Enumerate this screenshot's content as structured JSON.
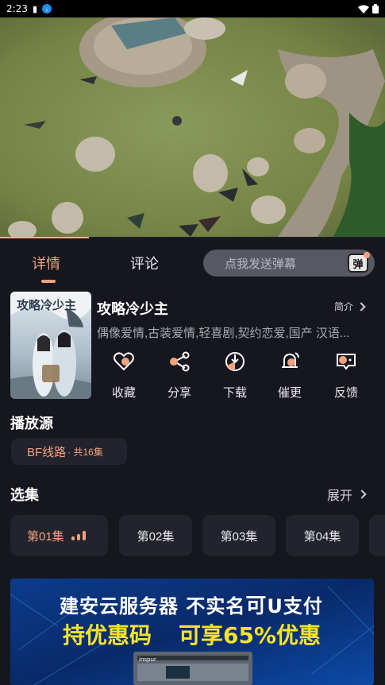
{
  "status_bar": {
    "time": "2:23"
  },
  "tabs": {
    "details": "详情",
    "comments": "评论"
  },
  "danmaku": {
    "placeholder": "点我发送弹幕",
    "button_label": "弹"
  },
  "show": {
    "title": "攻略冷少主",
    "intro_label": "简介",
    "tags": "偶像爱情,古装爱情,轻喜剧,契约恋爱,国产 汉语..."
  },
  "actions": [
    {
      "label": "收藏",
      "icon": "heart-icon"
    },
    {
      "label": "分享",
      "icon": "share-icon"
    },
    {
      "label": "下载",
      "icon": "download-icon"
    },
    {
      "label": "催更",
      "icon": "bell-icon"
    },
    {
      "label": "反馈",
      "icon": "feedback-icon"
    }
  ],
  "play_source": {
    "title": "播放源",
    "source_name": "BF线路",
    "count_text": "· 共16集"
  },
  "episodes": {
    "title": "选集",
    "expand_label": "展开",
    "items": [
      "第01集",
      "第02集",
      "第03集",
      "第04集"
    ]
  },
  "ad": {
    "line1_a": "建安云服务器 不实名",
    "line1_b": "可",
    "line1_c": "U支付",
    "line2_a": "持优惠码",
    "line2_b": "可享65%优惠",
    "brand": "inspur"
  },
  "colors": {
    "accent": "#f2a27d",
    "background": "#16161e",
    "chip": "#23232d",
    "ad_yellow": "#f8e32a"
  }
}
